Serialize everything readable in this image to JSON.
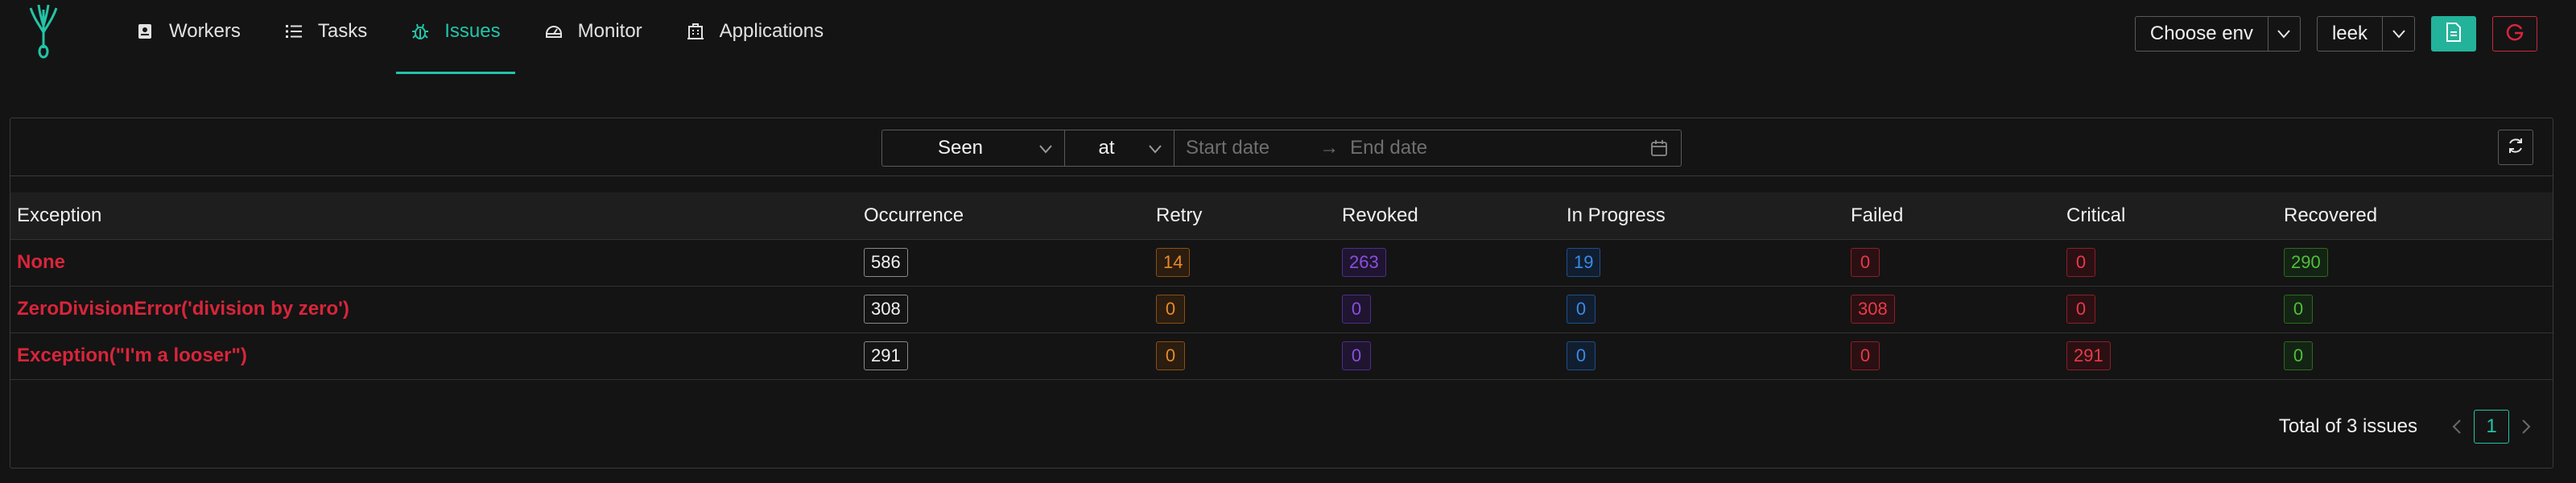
{
  "nav": {
    "items": [
      {
        "label": "Workers",
        "icon": "id-card-icon",
        "active": false
      },
      {
        "label": "Tasks",
        "icon": "list-icon",
        "active": false
      },
      {
        "label": "Issues",
        "icon": "bug-icon",
        "active": true
      },
      {
        "label": "Monitor",
        "icon": "dashboard-icon",
        "active": false
      },
      {
        "label": "Applications",
        "icon": "building-icon",
        "active": false
      }
    ]
  },
  "toolbar": {
    "env_select": "Choose env",
    "app_select": "leek"
  },
  "filters": {
    "seen": "Seen",
    "at": "at",
    "start_placeholder": "Start date",
    "end_placeholder": "End date"
  },
  "table": {
    "columns": [
      "Exception",
      "Occurrence",
      "Retry",
      "Revoked",
      "In Progress",
      "Failed",
      "Critical",
      "Recovered"
    ],
    "rows": [
      {
        "exception": "None",
        "occurrence": "586",
        "retry": "14",
        "revoked": "263",
        "in_progress": "19",
        "failed": "0",
        "critical": "0",
        "recovered": "290"
      },
      {
        "exception": "ZeroDivisionError('division by zero')",
        "occurrence": "308",
        "retry": "0",
        "revoked": "0",
        "in_progress": "0",
        "failed": "308",
        "critical": "0",
        "recovered": "0"
      },
      {
        "exception": "Exception(\"I'm a looser\")",
        "occurrence": "291",
        "retry": "0",
        "revoked": "0",
        "in_progress": "0",
        "failed": "0",
        "critical": "291",
        "recovered": "0"
      }
    ]
  },
  "pagination": {
    "total": "Total of 3 issues",
    "current_page": "1"
  },
  "colors": {
    "accent": "#23c4a7",
    "danger": "#d8253a",
    "background": "#141414"
  }
}
